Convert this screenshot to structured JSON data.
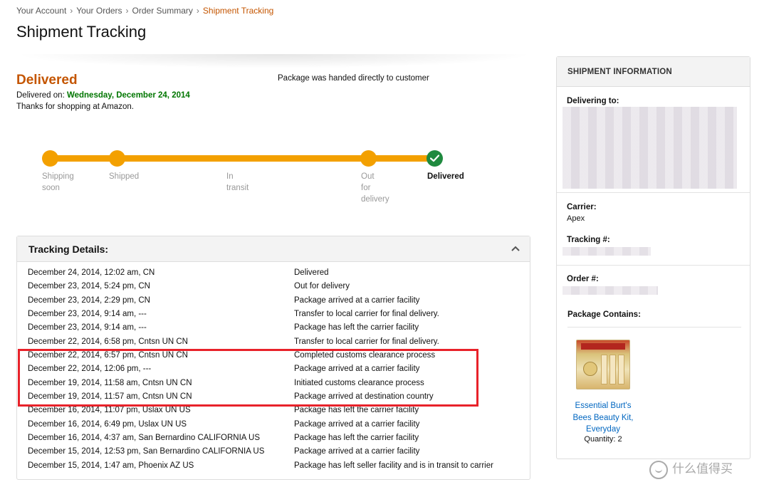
{
  "breadcrumb": {
    "items": [
      "Your Account",
      "Your Orders",
      "Order Summary"
    ],
    "separator": "›",
    "current": "Shipment Tracking"
  },
  "page_title": "Shipment Tracking",
  "status": {
    "heading": "Delivered",
    "delivered_on_label": "Delivered on:",
    "delivered_on_date": "Wednesday, December 24, 2014",
    "thanks": "Thanks for shopping at Amazon.",
    "handed_note": "Package was handed directly to customer"
  },
  "progress": {
    "steps": [
      {
        "label_line1": "Shipping",
        "label_line2": "soon",
        "label_line3": ""
      },
      {
        "label_line1": "Shipped",
        "label_line2": "",
        "label_line3": ""
      },
      {
        "label_line1": "In",
        "label_line2": "transit",
        "label_line3": ""
      },
      {
        "label_line1": "Out",
        "label_line2": "for",
        "label_line3": "delivery"
      },
      {
        "label_line1": "Delivered",
        "label_line2": "",
        "label_line3": ""
      }
    ],
    "completed_fraction": 1.0,
    "colors": {
      "track": "#f3a000",
      "complete": "#1f8a3f"
    }
  },
  "tracking": {
    "title": "Tracking Details:",
    "events": [
      {
        "when": "December 24, 2014, 12:02 am,   CN",
        "what": "Delivered"
      },
      {
        "when": "December 23, 2014, 5:24 pm,   CN",
        "what": "Out for delivery"
      },
      {
        "when": "December 23, 2014, 2:29 pm,   CN",
        "what": "Package arrived at a carrier facility"
      },
      {
        "when": "December 23, 2014, 9:14 am, ---",
        "what": "Transfer to local carrier for final delivery."
      },
      {
        "when": "December 23, 2014, 9:14 am, ---",
        "what": "Package has left the carrier facility"
      },
      {
        "when": "December 22, 2014, 6:58 pm, Cntsn UN CN",
        "what": "Transfer to local carrier for final delivery."
      },
      {
        "when": "December 22, 2014, 6:57 pm, Cntsn UN CN",
        "what": "Completed customs clearance process"
      },
      {
        "when": "December 22, 2014, 12:06 pm, ---",
        "what": "Package arrived at a carrier facility"
      },
      {
        "when": "December 19, 2014, 11:58 am, Cntsn UN CN",
        "what": "Initiated customs clearance process"
      },
      {
        "when": "December 19, 2014, 11:57 am, Cntsn UN CN",
        "what": "Package arrived at destination country"
      },
      {
        "when": "December 16, 2014, 11:07 pm, Uslax UN US",
        "what": "Package has left the carrier facility"
      },
      {
        "when": "December 16, 2014, 6:49 pm, Uslax UN US",
        "what": "Package arrived at a carrier facility"
      },
      {
        "when": "December 16, 2014, 4:37 am, San Bernardino CALIFORNIA US",
        "what": "Package has left the carrier facility"
      },
      {
        "when": "December 15, 2014, 12:53 pm, San Bernardino CALIFORNIA US",
        "what": "Package arrived at a carrier facility"
      },
      {
        "when": "December 15, 2014, 1:47 am, Phoenix AZ US",
        "what": "Package has left seller facility and is in transit to carrier"
      }
    ],
    "highlight_color": "#e8222a"
  },
  "shipment_info": {
    "title": "SHIPMENT INFORMATION",
    "delivering_to_label": "Delivering to:",
    "carrier_label": "Carrier:",
    "carrier_value": "Apex",
    "tracking_label": "Tracking #:",
    "order_label": "Order #:",
    "package_contains_label": "Package Contains:",
    "item": {
      "name_line1": "Essential Burt's",
      "name_line2": "Bees Beauty Kit,",
      "name_line3": "Everyday",
      "quantity": "Quantity: 2"
    }
  },
  "watermark": "什么值得买",
  "colors": {
    "brand_orange": "#c45500",
    "delivered_green": "#007600",
    "link_blue": "#0066c0"
  }
}
